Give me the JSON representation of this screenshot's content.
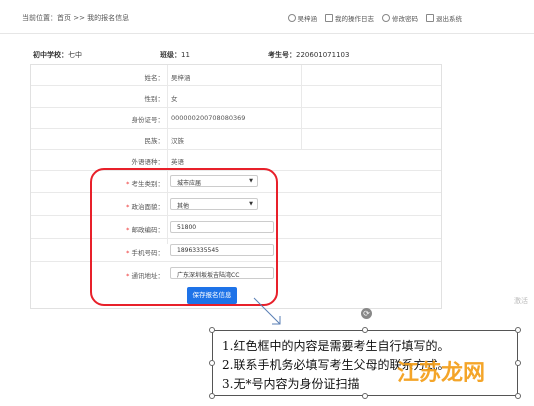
{
  "breadcrumb": "当前位置：首页 >> 我的报名信息",
  "top_links": [
    {
      "label": "吴梓涵",
      "icon": "user-icon"
    },
    {
      "label": "我的操作日志",
      "icon": "log-icon"
    },
    {
      "label": "修改密码",
      "icon": "gear-icon"
    },
    {
      "label": "退出系统",
      "icon": "exit-icon"
    }
  ],
  "info": {
    "school_label": "初中学校：",
    "school_value": "七中",
    "class_label": "班级：",
    "class_value": "11",
    "exam_no_label": "考生号：",
    "exam_no_value": "220601071103"
  },
  "fields": [
    {
      "label": "姓名：",
      "value": "吴梓涵"
    },
    {
      "label": "性别：",
      "value": "女"
    },
    {
      "label": "身份证号：",
      "value": "000000200708080369"
    },
    {
      "label": "民族：",
      "value": "汉族"
    },
    {
      "label": "外语语种：",
      "value": "英语"
    }
  ],
  "editable": {
    "category_label": "考生类别：",
    "category_value": "城市应届",
    "politics_label": "政治面貌：",
    "politics_value": "其他",
    "postcode_label": "邮政编码：",
    "postcode_value": "51800",
    "phone_label": "手机号码：",
    "phone_value": "18963335545",
    "address_label": "通讯地址：",
    "address_value": "广东深圳坂坂吉陆湾CC"
  },
  "save_label": "保存报名信息",
  "notes": [
    "1.红色框中的内容是需要考生自行填写的。",
    "2.联系手机务必填写考生父母的联系方式。",
    "3.无*号内容为身份证扫描"
  ],
  "watermark": "江苏龙网",
  "side_hint": "激活",
  "colors": {
    "accent": "#1e73e8",
    "highlight": "#e8202a"
  }
}
